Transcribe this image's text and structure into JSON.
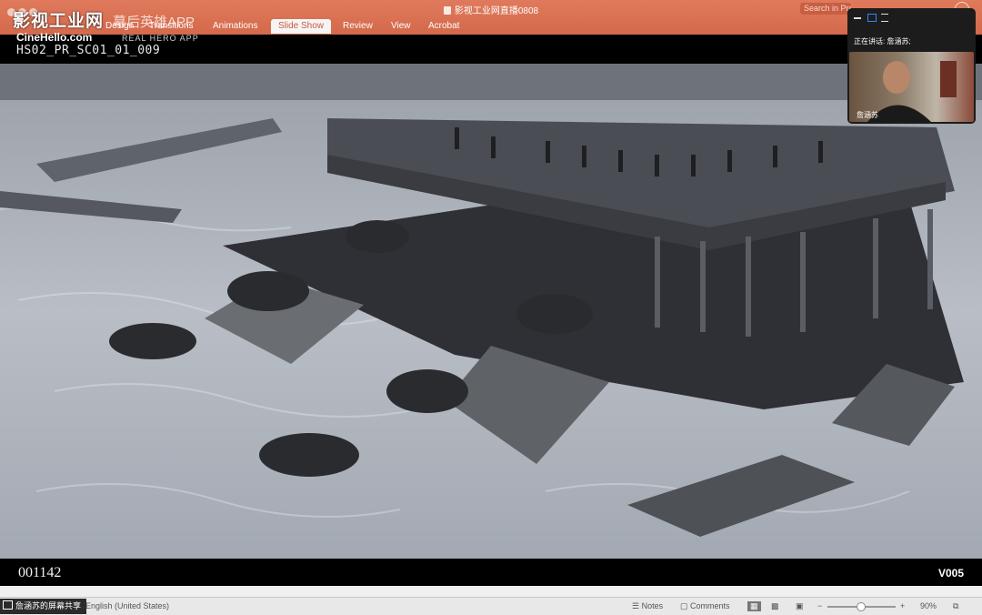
{
  "window": {
    "title": "影视工业网直播0808"
  },
  "tabs": [
    {
      "label": "Design"
    },
    {
      "label": "Transitions"
    },
    {
      "label": "Animations"
    },
    {
      "label": "Slide Show"
    },
    {
      "label": "Review"
    },
    {
      "label": "View"
    },
    {
      "label": "Acrobat"
    }
  ],
  "search": {
    "placeholder": "Search in Presentation"
  },
  "watermark": {
    "cn": "影视工业网",
    "cn_sub": "幕后英雄APP",
    "en": "CineHello.com",
    "en_sub": "REAL HERO APP"
  },
  "slide": {
    "shot_code": "HS02_PR_SC01_01_009",
    "frame_counter": "001142",
    "version": "V005"
  },
  "call": {
    "speaking_label": "正在讲话: 詹涵苏;",
    "participant_name": "詹涵苏"
  },
  "status": {
    "share_label": "詹涵苏的屏幕共享",
    "language": "English (United States)",
    "notes": "Notes",
    "comments": "Comments",
    "zoom": "90%"
  },
  "colors": {
    "accent": "#d4694b",
    "bar": "#e8e8e8"
  }
}
